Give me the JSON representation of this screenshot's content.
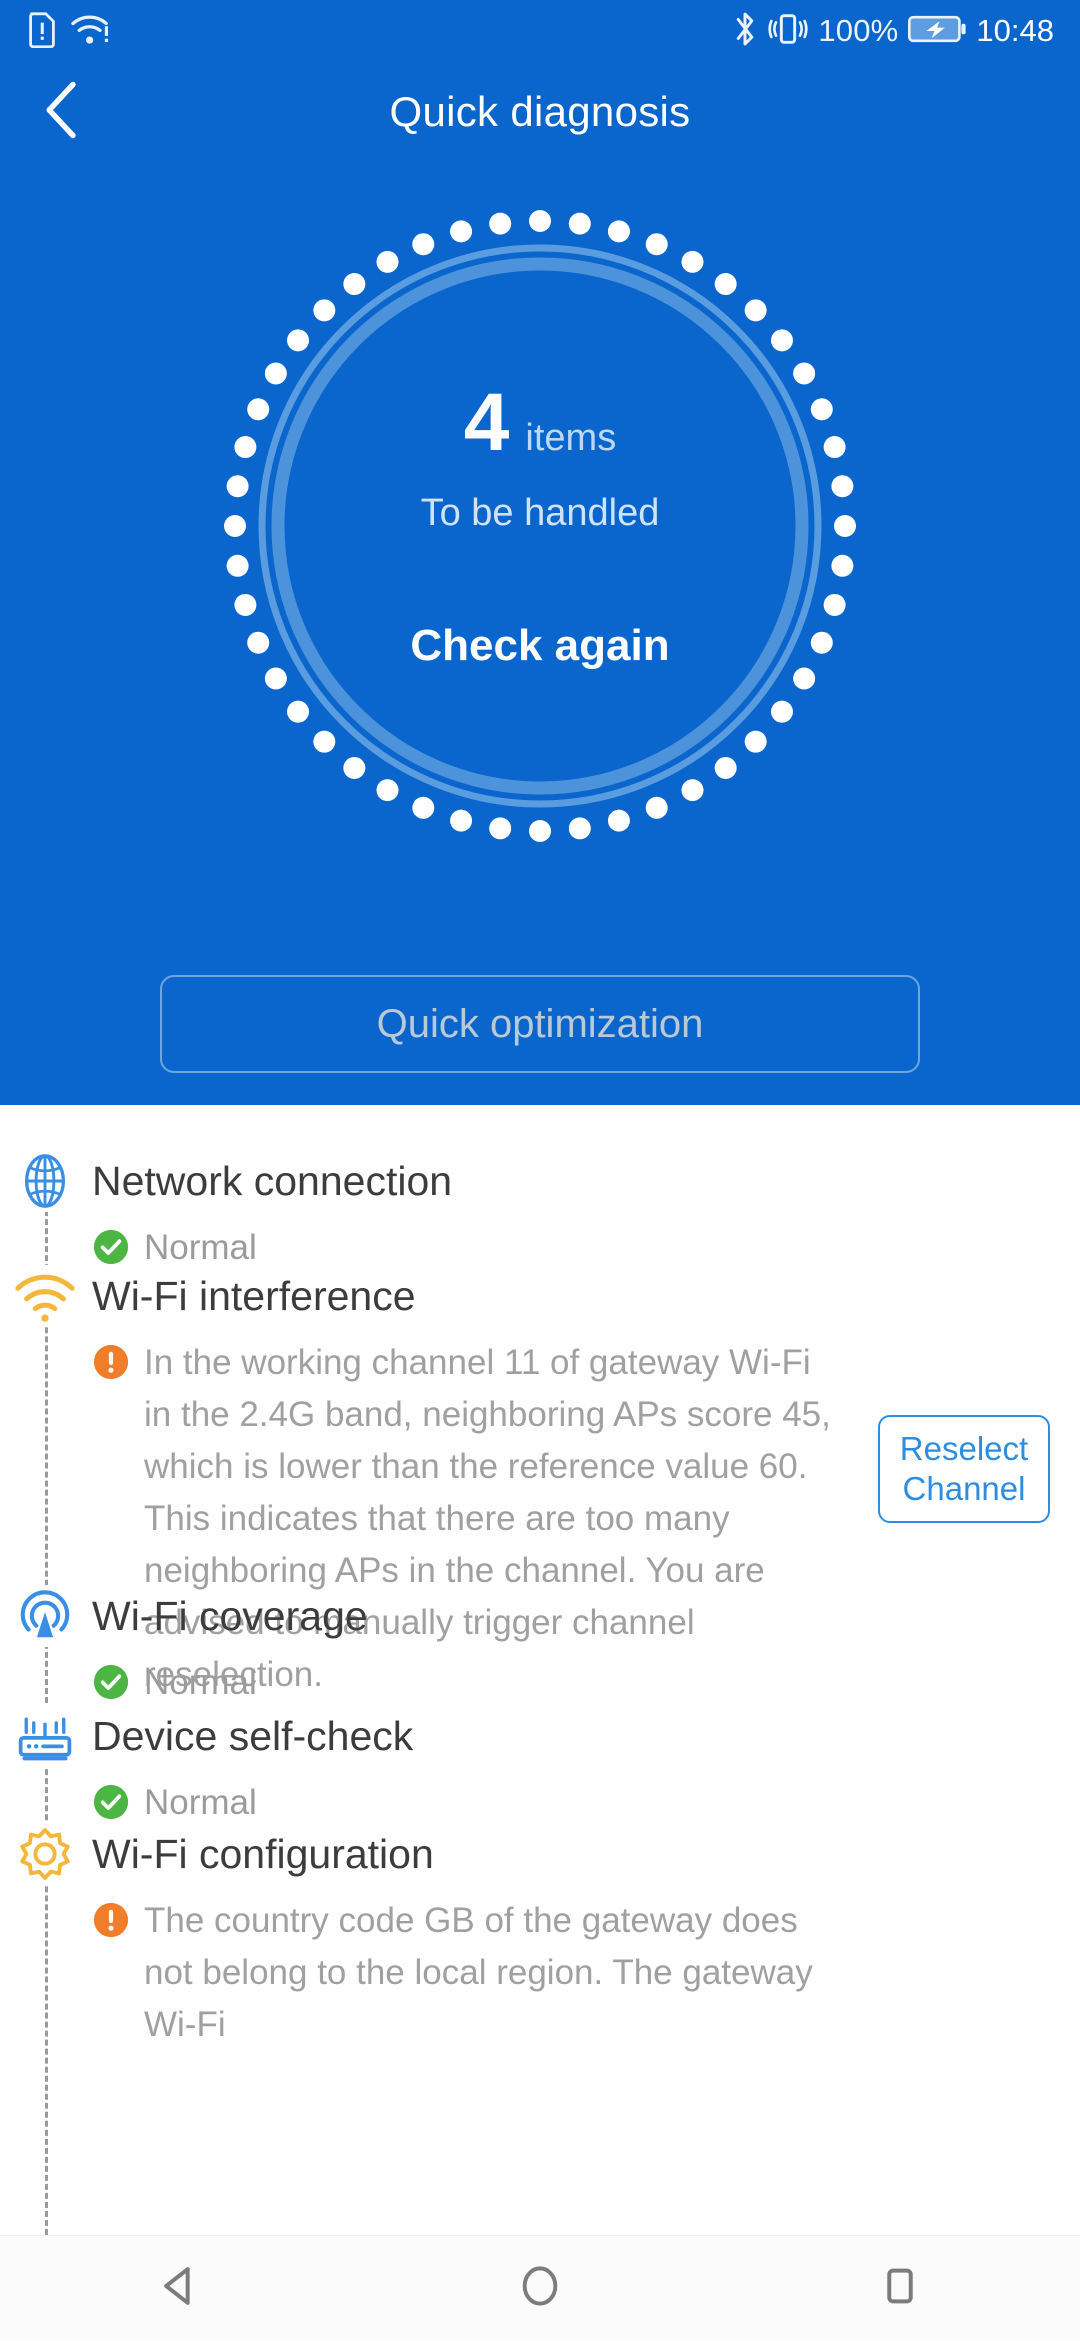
{
  "statusbar": {
    "icons_left": [
      "sim-alert-icon",
      "wifi-alert-icon"
    ],
    "bluetooth": "bluetooth-icon",
    "vibrate": "vibrate-icon",
    "battery_percent": "100%",
    "battery": "battery-charging-icon",
    "time": "10:48"
  },
  "header": {
    "back": "back-chevron-icon",
    "title": "Quick diagnosis"
  },
  "gauge": {
    "count": "4",
    "unit": "items",
    "subtitle": "To be handled",
    "action": "Check again"
  },
  "optimize_button": {
    "label": "Quick optimization"
  },
  "theme": {
    "brand_blue": "#0a66cc",
    "ring_light": "#5e9fe0",
    "dot_white": "#ffffff",
    "ok_green": "#4cb544",
    "warn_orange": "#f07d2a",
    "icon_blue": "#3a8ee6",
    "icon_amber": "#f5b63c",
    "link_blue": "#2d8ee0",
    "body_gray": "#a0a0a0",
    "title_gray": "#3c3c3c"
  },
  "items": [
    {
      "icon": "globe-icon",
      "icon_color": "#3a8ee6",
      "title": "Network connection",
      "status": "ok",
      "status_text": "Normal",
      "action": null
    },
    {
      "icon": "wifi-interference-icon",
      "icon_color": "#f5b63c",
      "title": "Wi-Fi interference",
      "status": "warn",
      "status_text": "In the working channel 11 of gateway Wi-Fi in the 2.4G band, neighboring APs score 45, which is lower than the reference value 60. This indicates that there are too many neighboring APs in the channel. You are advised to manually trigger channel reselection.",
      "action": "Reselect Channel"
    },
    {
      "icon": "wifi-coverage-icon",
      "icon_color": "#3a8ee6",
      "title": "Wi-Fi coverage",
      "status": "ok",
      "status_text": "Normal",
      "action": null
    },
    {
      "icon": "router-icon",
      "icon_color": "#3a8ee6",
      "title": "Device self-check",
      "status": "ok",
      "status_text": "Normal",
      "action": null
    },
    {
      "icon": "gear-icon",
      "icon_color": "#f5b63c",
      "title": "Wi-Fi configuration",
      "status": "warn",
      "status_text": "The country code GB of the gateway does not belong to the local region. The gateway Wi-Fi",
      "action": null
    }
  ],
  "navbar": {
    "back": "nav-back-triangle-icon",
    "home": "nav-home-circle-icon",
    "recents": "nav-recents-square-icon"
  }
}
